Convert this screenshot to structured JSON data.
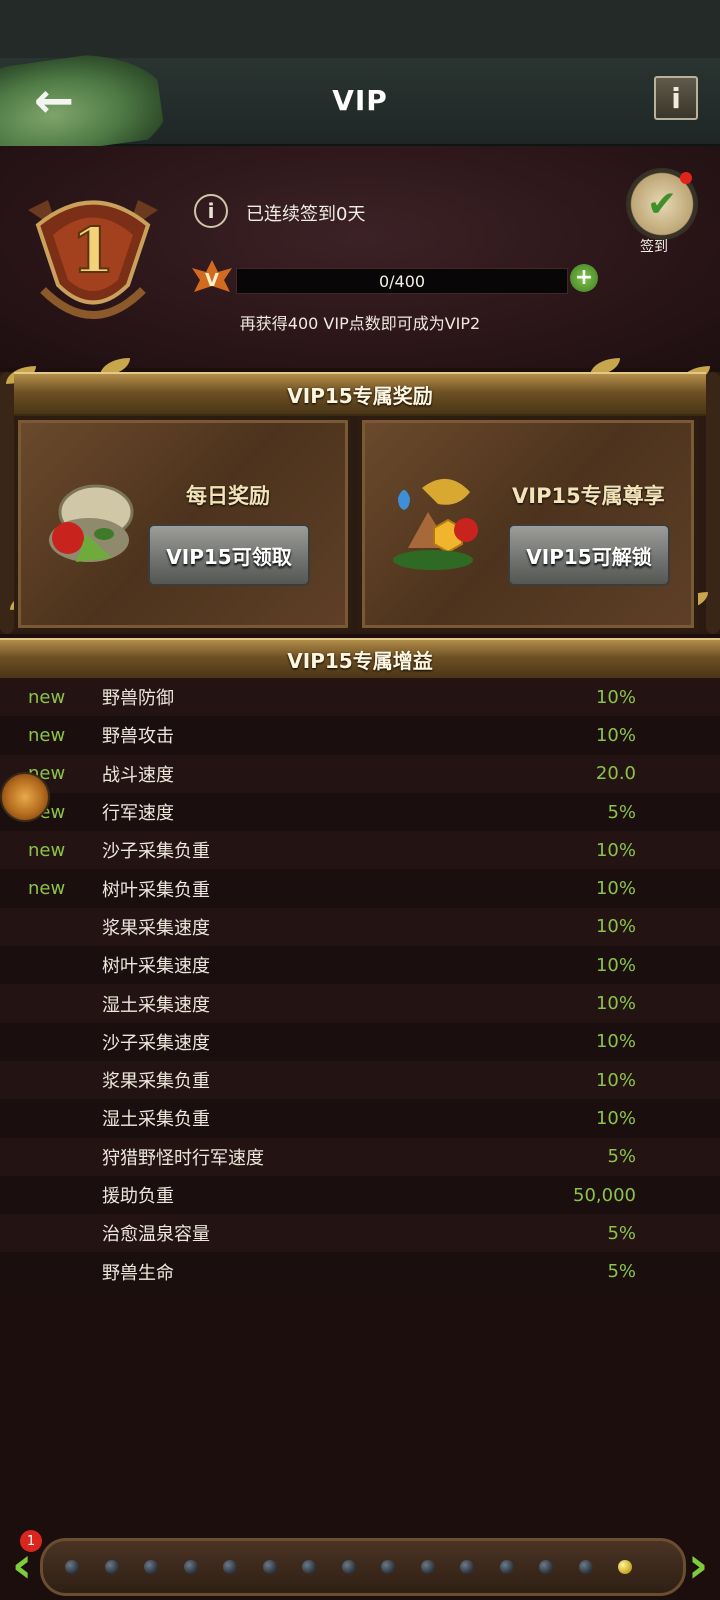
{
  "top_bar": {
    "title": "VIP",
    "back_icon": "←",
    "info_icon": "i"
  },
  "header": {
    "vip_level": "1",
    "signin_status": "已连续签到0天",
    "signin_label": "签到",
    "progress": {
      "current": 0,
      "max": 400,
      "text": "0/400",
      "fraction": 0
    },
    "next_level_hint": "再获得400 VIP点数即可成为VIP2"
  },
  "rewards": {
    "banner": "VIP15专属奖励",
    "daily": {
      "title": "每日奖励",
      "button": "VIP15可领取"
    },
    "exclusive": {
      "title": "VIP15专属尊享",
      "button": "VIP15可解锁"
    }
  },
  "buffs": {
    "banner": "VIP15专属增益",
    "items": [
      {
        "new": "new",
        "name": "野兽防御",
        "value": "10%"
      },
      {
        "new": "new",
        "name": "野兽攻击",
        "value": "10%"
      },
      {
        "new": "new",
        "name": "战斗速度",
        "value": "20.0"
      },
      {
        "new": "new",
        "name": "行军速度",
        "value": "5%"
      },
      {
        "new": "new",
        "name": "沙子采集负重",
        "value": "10%"
      },
      {
        "new": "new",
        "name": "树叶采集负重",
        "value": "10%"
      },
      {
        "new": "",
        "name": "浆果采集速度",
        "value": "10%"
      },
      {
        "new": "",
        "name": "树叶采集速度",
        "value": "10%"
      },
      {
        "new": "",
        "name": "湿土采集速度",
        "value": "10%"
      },
      {
        "new": "",
        "name": "沙子采集速度",
        "value": "10%"
      },
      {
        "new": "",
        "name": "浆果采集负重",
        "value": "10%"
      },
      {
        "new": "",
        "name": "湿土采集负重",
        "value": "10%"
      },
      {
        "new": "",
        "name": "狩猎野怪时行军速度",
        "value": "5%"
      },
      {
        "new": "",
        "name": "援助负重",
        "value": "50,000"
      },
      {
        "new": "",
        "name": "治愈温泉容量",
        "value": "5%"
      },
      {
        "new": "",
        "name": "野兽生命",
        "value": "5%"
      }
    ]
  },
  "pager": {
    "badge": "1",
    "total_dots": 15,
    "active_index": 14
  },
  "colors": {
    "accent_green": "#8bc34a",
    "gold": "#b38e4a",
    "background": "#1c0e0d"
  }
}
